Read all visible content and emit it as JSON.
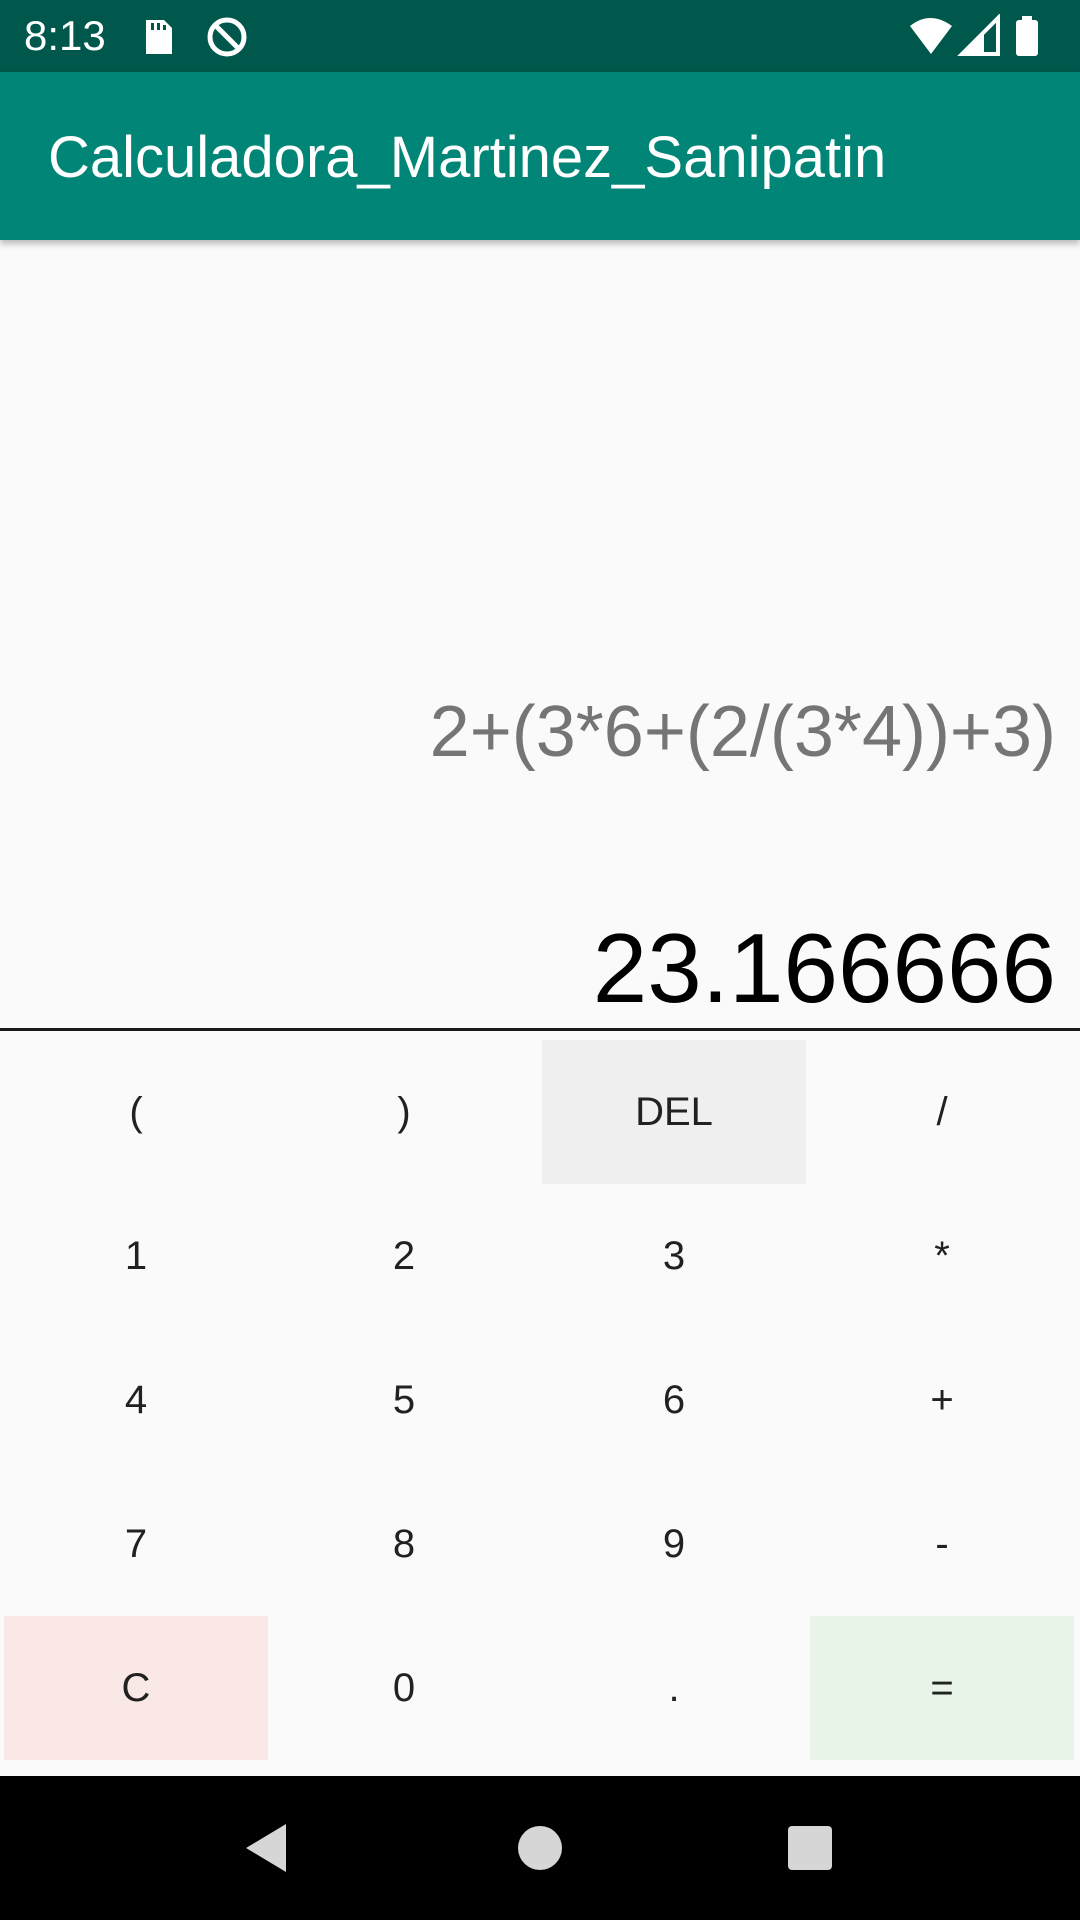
{
  "status_bar": {
    "time": "8:13",
    "left_icons": [
      "sd-card-icon",
      "no-location-icon"
    ],
    "right_icons": [
      "wifi-icon",
      "cell-signal-icon",
      "battery-icon"
    ]
  },
  "app_bar": {
    "title": "Calculadora_Martinez_Sanipatin",
    "color": "#008577",
    "status_color": "#00574b"
  },
  "display": {
    "expression": "2+(3*6+(2/(3*4))+3)",
    "result": "23.166666"
  },
  "keypad": {
    "rows": [
      [
        "(",
        ")",
        "DEL",
        "/"
      ],
      [
        "1",
        "2",
        "3",
        "*"
      ],
      [
        "4",
        "5",
        "6",
        "+"
      ],
      [
        "7",
        "8",
        "9",
        "-"
      ],
      [
        "C",
        "0",
        ".",
        "="
      ]
    ],
    "colors": {
      "del": "#efefef",
      "clear": "#fae8e6",
      "equals": "#e7f4e7"
    }
  },
  "nav_bar": {
    "buttons": [
      "back-icon",
      "home-icon",
      "recents-icon"
    ]
  }
}
